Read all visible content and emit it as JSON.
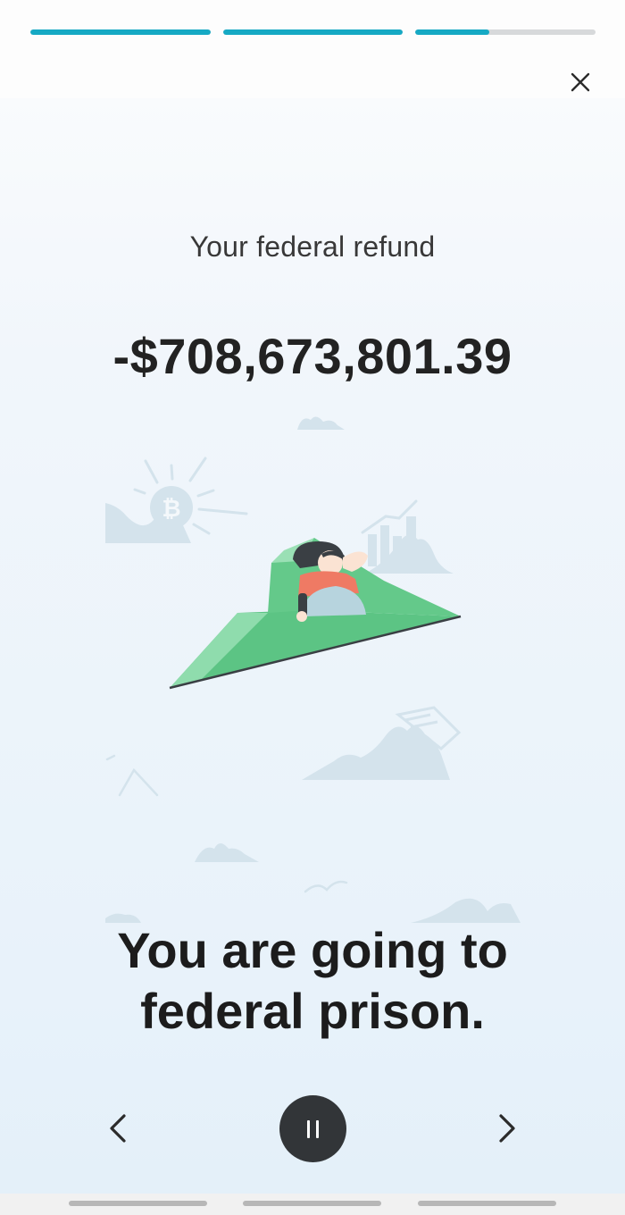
{
  "story": {
    "progress_segments": [
      1,
      1,
      0.41
    ],
    "refund_label": "Your federal refund",
    "refund_amount": "-$708,673,801.39",
    "message": "You are going to federal prison."
  },
  "icons": {
    "close": "close-icon",
    "previous": "chevron-left-icon",
    "pause": "pause-icon",
    "next": "chevron-right-icon",
    "coin": "bitcoin-icon"
  },
  "colors": {
    "accent": "#16a9c4",
    "track": "#d7d9db",
    "text": "#222222",
    "pause_button": "#323538",
    "decor": "#cfe0ea",
    "plane": "#5cc484",
    "person_shirt": "#ef7a64"
  }
}
